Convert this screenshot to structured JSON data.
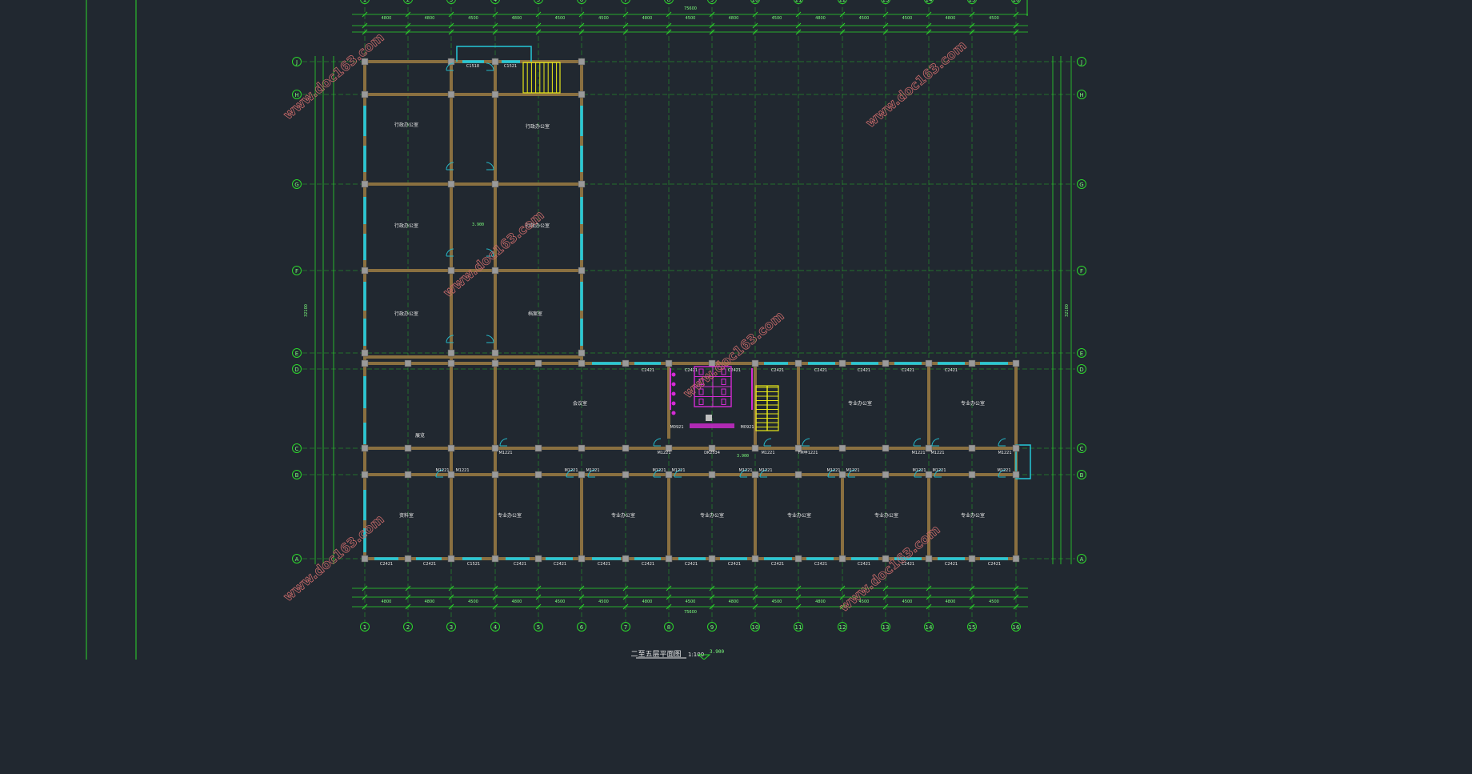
{
  "drawing": {
    "title": "二至五层平面图",
    "scale": "1:100",
    "level": "3.900",
    "watermark": "www.doc163.com",
    "colors": {
      "background": "#212830",
      "grid": "#2bd62b",
      "wall": "#8a7040",
      "window": "#25c8d8",
      "stair": "#e8e81a",
      "toilet": "#d52bd5",
      "door": "#25b8c8",
      "watermark": "#c86a6a",
      "text": "#e8e8e8"
    }
  },
  "axes": {
    "columns": [
      "1",
      "2",
      "3",
      "4",
      "5",
      "6",
      "7",
      "8",
      "9",
      "10",
      "11",
      "12",
      "13",
      "14",
      "15",
      "16"
    ],
    "rows": [
      "A",
      "B",
      "C",
      "D",
      "E",
      "F",
      "G",
      "H",
      "J"
    ]
  },
  "dims": {
    "total": "75600",
    "top_row1": [
      "4800",
      "4800",
      "4500",
      "4800",
      "4500",
      "4500",
      "4800",
      "4500",
      "4800",
      "4500",
      "4800",
      "4500",
      "4500",
      "4800",
      "4500"
    ],
    "bottom_row1": [
      "4800",
      "4800",
      "4500",
      "4800",
      "4500",
      "4500",
      "4800",
      "4500",
      "4800",
      "4500",
      "4800",
      "4500",
      "4500",
      "4800",
      "4500"
    ],
    "left_total": "32100",
    "right_total": "32100"
  },
  "rooms": [
    {
      "label": "行政办公室",
      "pos": "r1"
    },
    {
      "label": "行政办公室",
      "pos": "r2"
    },
    {
      "label": "行政办公室",
      "pos": "r3"
    },
    {
      "label": "行政办公室",
      "pos": "r4"
    },
    {
      "label": "行政办公室",
      "pos": "r5"
    },
    {
      "label": "档案室",
      "pos": "r6"
    },
    {
      "label": "会议室",
      "pos": "r7"
    },
    {
      "label": "专业办公室",
      "pos": "r8"
    },
    {
      "label": "专业办公室",
      "pos": "r9"
    },
    {
      "label": "展览",
      "pos": "r10"
    },
    {
      "label": "资料室",
      "pos": "r11"
    },
    {
      "label": "专业办公室",
      "pos": "r12"
    },
    {
      "label": "专业办公室",
      "pos": "r13"
    },
    {
      "label": "专业办公室",
      "pos": "r14"
    },
    {
      "label": "专业办公室",
      "pos": "r15"
    },
    {
      "label": "专业办公室",
      "pos": "r16"
    },
    {
      "label": "专业办公室",
      "pos": "r17"
    }
  ],
  "windows_top": [
    "C2421",
    "C2421",
    "C2421",
    "C2421",
    "C2421",
    "C2421",
    "C2421",
    "C2421"
  ],
  "windows_bottom": [
    "C2421",
    "C2421",
    "C1521",
    "C2421",
    "C2421",
    "C2421",
    "C2421",
    "C2421",
    "C2421",
    "C2421",
    "C2421",
    "C2421",
    "C2421",
    "C2421",
    "C2421"
  ],
  "doors_c": [
    "M1221",
    "M1221",
    "FM甲1221",
    "M1221",
    "M1221",
    "M1221",
    "M1221"
  ],
  "doors_b": [
    "M1221",
    "M1221",
    "M1221",
    "M1221",
    "M1221",
    "M1221",
    "M1221",
    "M1221",
    "M1221",
    "M1221",
    "M1221",
    "M1221",
    "M1221",
    "M1221",
    "M1221"
  ],
  "misc": {
    "door_dk": "DK2534",
    "toilet_m": "M0921",
    "stair_fm": "FM甲1221",
    "top_win": "C1518",
    "top_win2": "C1521"
  }
}
